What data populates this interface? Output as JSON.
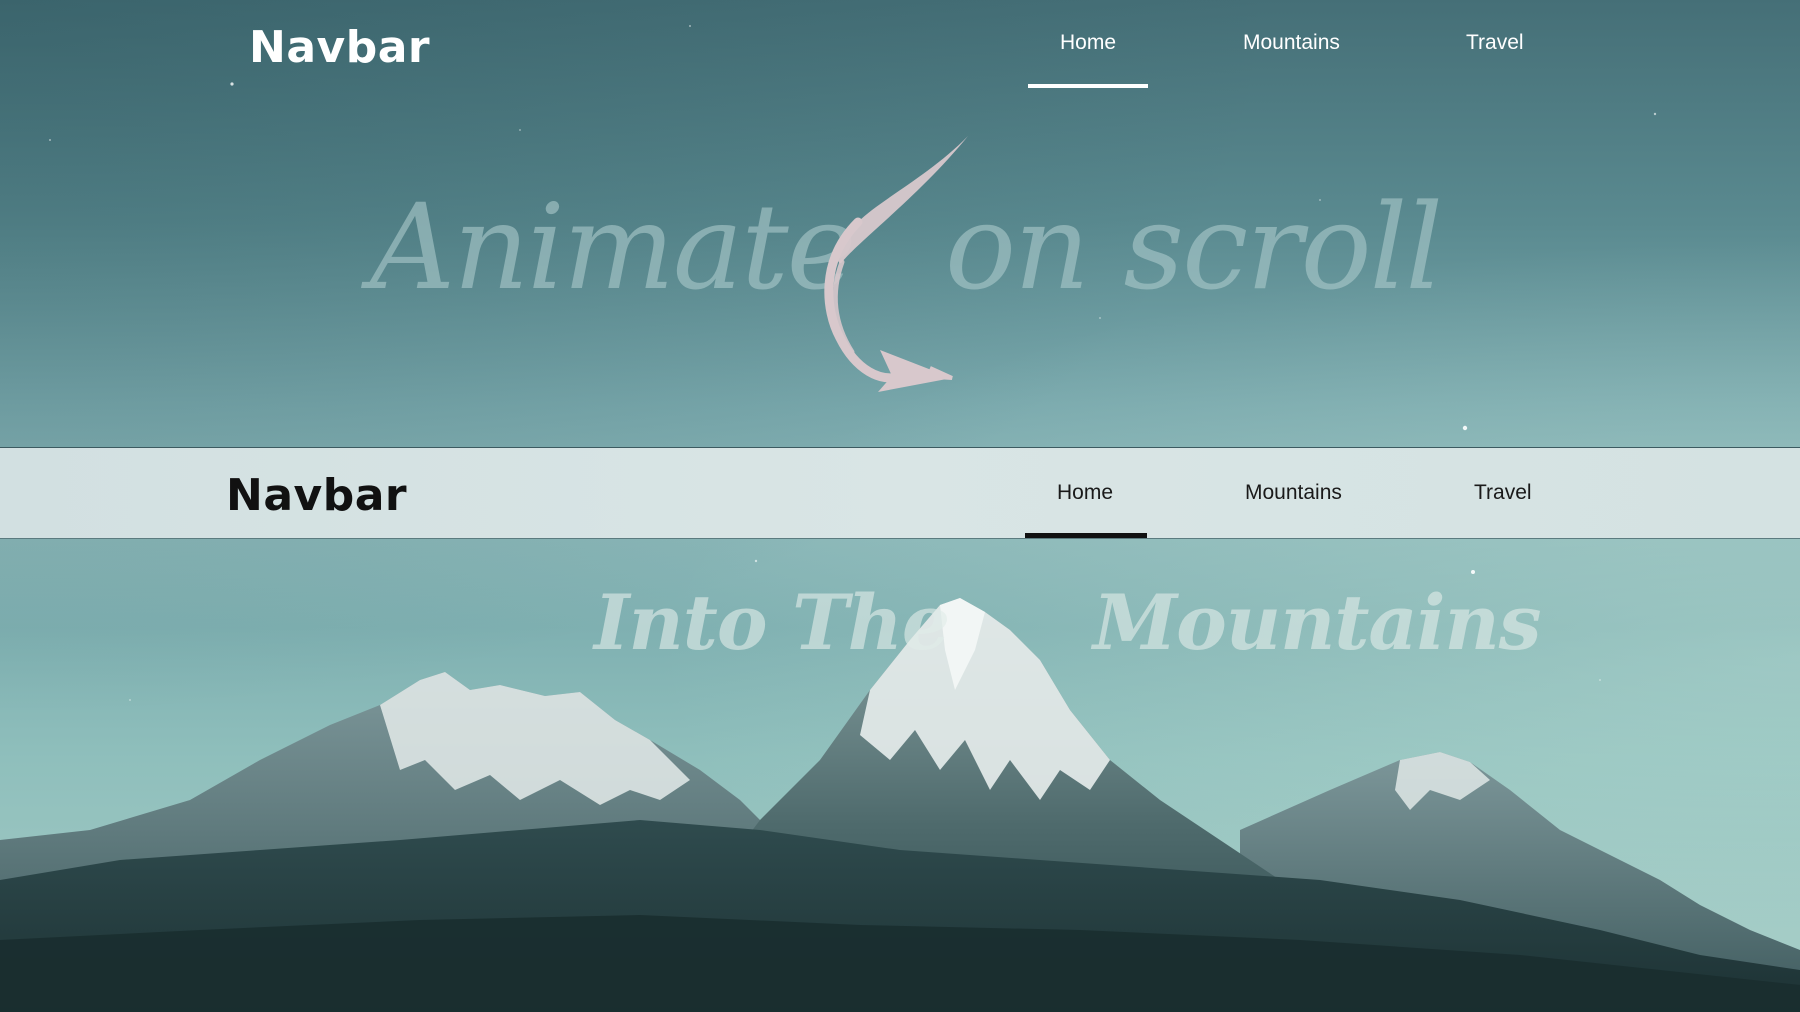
{
  "top_navbar": {
    "brand": "Navbar",
    "links": [
      {
        "label": "Home",
        "active": true
      },
      {
        "label": "Mountains",
        "active": false
      },
      {
        "label": "Travel",
        "active": false
      }
    ]
  },
  "hero": {
    "headline_left": "Animate",
    "headline_right": "on scroll",
    "arrow_icon": "curved-arrow-down-right-icon"
  },
  "scrolled_navbar": {
    "brand": "Navbar",
    "links": [
      {
        "label": "Home",
        "active": true
      },
      {
        "label": "Mountains",
        "active": false
      },
      {
        "label": "Travel",
        "active": false
      }
    ]
  },
  "mountains_section": {
    "title_left": "Into The",
    "title_right": "Mountains"
  },
  "colors": {
    "sky_top": "#456f77",
    "sky_bottom": "#a6ccc6",
    "navbar_solid_bg": "#d9e5e5",
    "arrow": "#d8c8cc",
    "brand_light": "#ffffff",
    "brand_dark": "#111111"
  }
}
